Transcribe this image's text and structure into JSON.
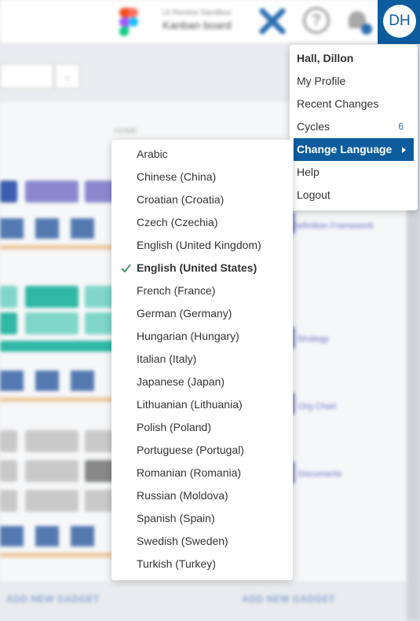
{
  "header": {
    "context_caption": "UI Review Sandbox",
    "context_title": "Kanban board"
  },
  "user": {
    "initials": "DH"
  },
  "user_menu": {
    "name": "Hall, Dillon",
    "items": [
      {
        "label": "My Profile"
      },
      {
        "label": "Recent Changes"
      },
      {
        "label": "Cycles",
        "count": "6"
      },
      {
        "label": "Change Language",
        "active": true
      },
      {
        "label": "Help"
      },
      {
        "label": "Logout"
      }
    ]
  },
  "language_menu": {
    "selected": "English (United States)",
    "items": [
      {
        "label": "Arabic"
      },
      {
        "label": "Chinese (China)"
      },
      {
        "label": "Croatian (Croatia)"
      },
      {
        "label": "Czech (Czechia)"
      },
      {
        "label": "English (United Kingdom)"
      },
      {
        "label": "English (United States)"
      },
      {
        "label": "French (France)"
      },
      {
        "label": "German (Germany)"
      },
      {
        "label": "Hungarian (Hungary)"
      },
      {
        "label": "Italian (Italy)"
      },
      {
        "label": "Japanese (Japan)"
      },
      {
        "label": "Lithuanian (Lithuania)"
      },
      {
        "label": "Polish (Poland)"
      },
      {
        "label": "Portuguese (Portugal)"
      },
      {
        "label": "Romanian (Romania)"
      },
      {
        "label": "Russian (Moldova)"
      },
      {
        "label": "Spanish (Spain)"
      },
      {
        "label": "Swedish (Sweden)"
      },
      {
        "label": "Turkish (Turkey)"
      }
    ]
  },
  "background": {
    "home_label": "HOME",
    "add_gadget_left": "ADD NEW GADGET",
    "add_gadget_right": "ADD NEW GADGET",
    "side_links": [
      "Definition Framework",
      "Strategy",
      "Org Chart",
      "Documents"
    ]
  },
  "colors": {
    "brand_blue": "#0d5c9e",
    "check_green": "#2e8b57"
  },
  "icons": [
    "figma-logo-icon",
    "x-logo-icon",
    "help-circle-icon",
    "bell-icon",
    "check-icon",
    "caret-right-icon",
    "search-icon"
  ]
}
